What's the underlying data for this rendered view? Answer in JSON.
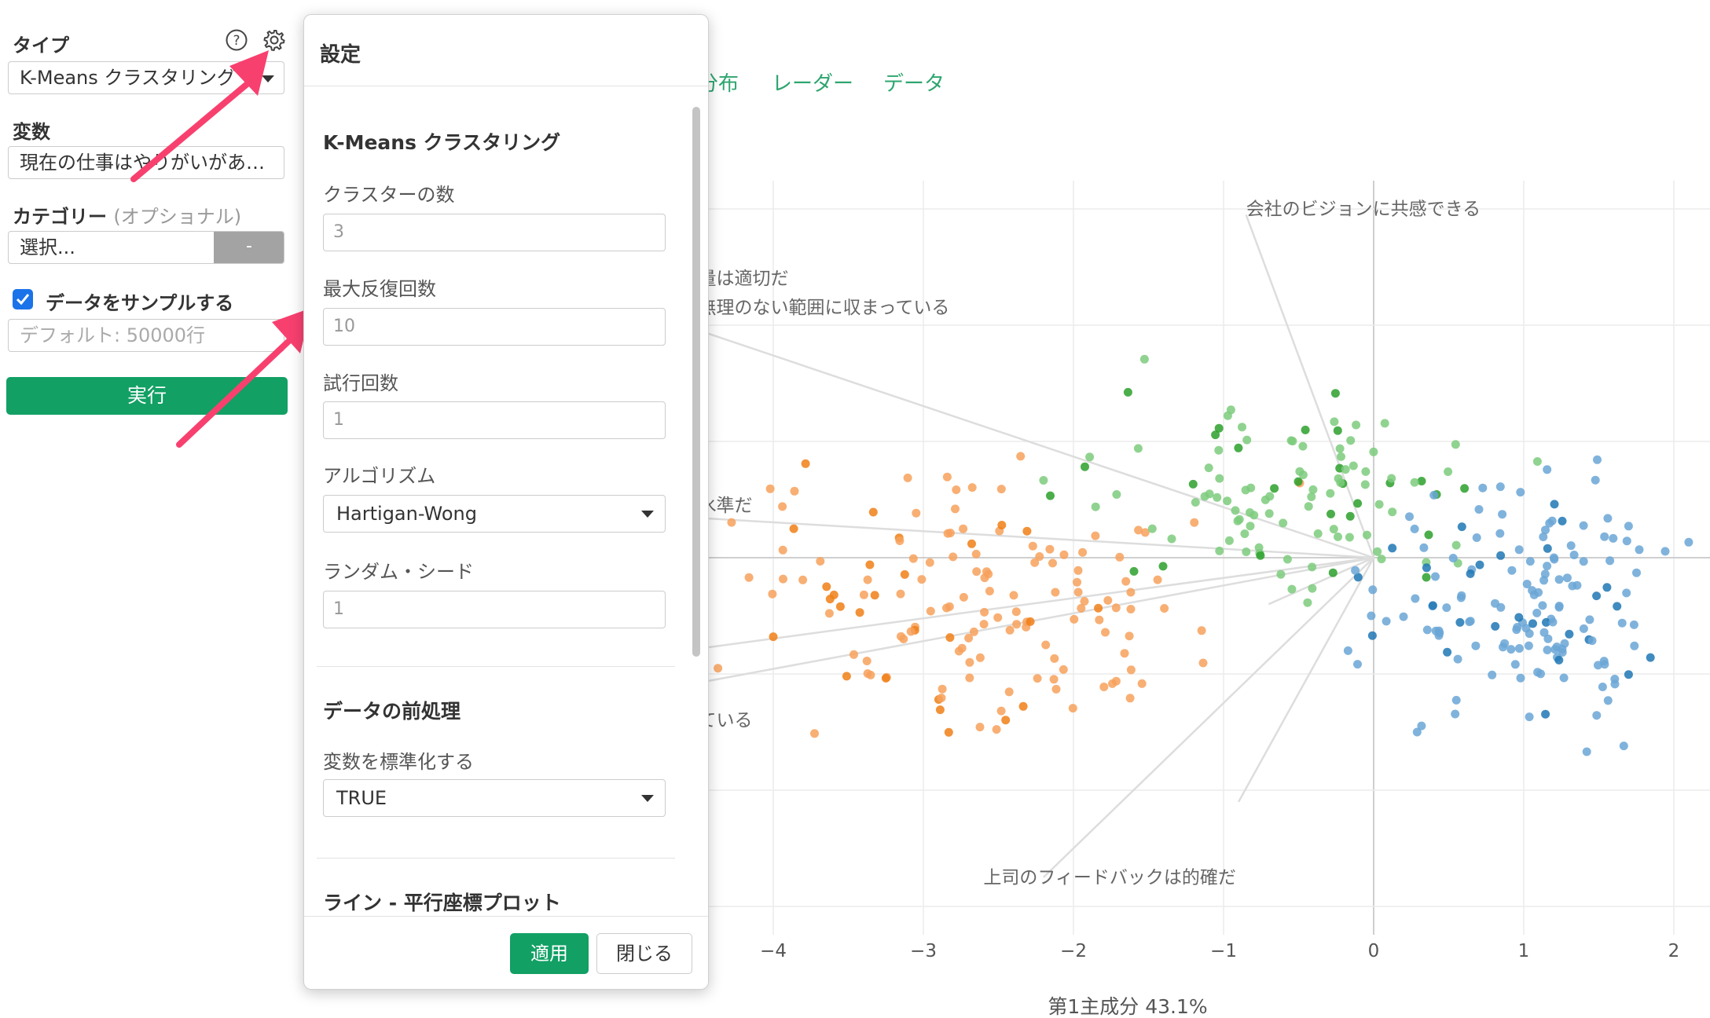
{
  "left_panel": {
    "type_label": "タイプ",
    "type_value": "K-Means クラスタリング",
    "variables_label": "変数",
    "variables_value": "現在の仕事はやりがいがあ…",
    "category_label": "カテゴリー",
    "category_optional": "(オプショナル)",
    "category_placeholder": "選択...",
    "category_button": "-",
    "sample_label": "データをサンプルする",
    "sample_checked": true,
    "sample_placeholder": "デフォルト: 50000行",
    "run_button": "実行",
    "help_icon": "question-circle-icon",
    "settings_icon": "gear-icon"
  },
  "tabs": [
    "分布",
    "レーダー",
    "データ"
  ],
  "dialog": {
    "title": "設定",
    "section_kmeans": "K-Means クラスタリング",
    "cluster_count_label": "クラスターの数",
    "cluster_count_value": "3",
    "max_iter_label": "最大反復回数",
    "max_iter_value": "10",
    "trials_label": "試行回数",
    "trials_value": "1",
    "algorithm_label": "アルゴリズム",
    "algorithm_value": "Hartigan-Wong",
    "seed_label": "ランダム・シード",
    "seed_value": "1",
    "section_preprocess": "データの前処理",
    "standardize_label": "変数を標準化する",
    "standardize_value": "TRUE",
    "section_line": "ライン - 平行座標プロット",
    "apply_button": "適用",
    "close_button": "閉じる"
  },
  "chart_data": {
    "type": "scatter",
    "xlabel": "第1主成分 43.1%",
    "x_ticks": [
      "−4",
      "−3",
      "−2",
      "−1",
      "0",
      "1",
      "2"
    ],
    "x_tick_values": [
      -4,
      -3,
      -2,
      -1,
      0,
      1,
      2
    ],
    "colors": {
      "cluster_orange": "#f7a15c",
      "cluster_orange_dark": "#f07f16",
      "cluster_green": "#7ccb7c",
      "cluster_green_dark": "#2ca02c",
      "cluster_blue": "#6aa6d6",
      "cluster_blue_dark": "#1f77b4"
    },
    "loading_labels": [
      {
        "text": "会社のビジョンに共感できる",
        "x": -0.85,
        "y": 2.95
      },
      {
        "text": "量は適切だ",
        "x": -4.5,
        "y": 2.35
      },
      {
        "text": "無理のない範囲に収まっている",
        "x": -4.5,
        "y": 2.1
      },
      {
        "text": "水準だ",
        "x": -4.5,
        "y": 0.4
      },
      {
        "text": "ている",
        "x": -4.5,
        "y": -1.45
      },
      {
        "text": "上司のフィードバックは的確だ",
        "x": -2.6,
        "y": -2.8
      }
    ],
    "loading_vectors": [
      {
        "x": -0.85,
        "y": 2.95
      },
      {
        "x": -4.6,
        "y": 2.0
      },
      {
        "x": -4.6,
        "y": 0.35
      },
      {
        "x": -4.6,
        "y": -1.1
      },
      {
        "x": -4.6,
        "y": -0.8
      },
      {
        "x": -2.2,
        "y": -2.75
      },
      {
        "x": -0.9,
        "y": -2.1
      },
      {
        "x": -0.7,
        "y": -0.4
      }
    ]
  }
}
